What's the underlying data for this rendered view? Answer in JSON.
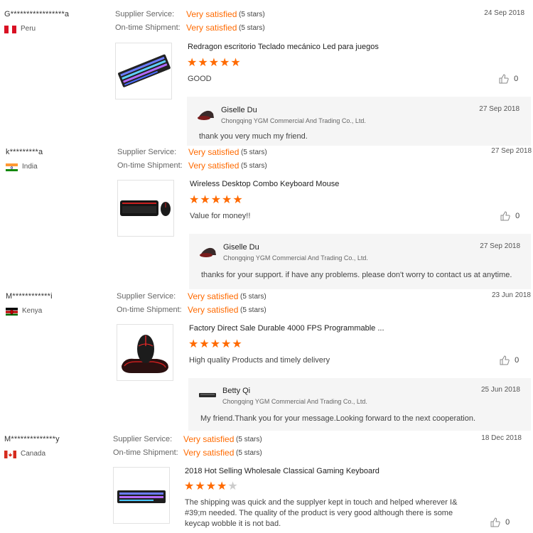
{
  "labels": {
    "supplier_service": "Supplier Service:",
    "ontime_shipment": "On-time Shipment:"
  },
  "reviews": [
    {
      "buyer": "G*****************a",
      "country": "Peru",
      "flag": "peru-flag-icon",
      "date": "24 Sep 2018",
      "supplier_service": "Very satisfied",
      "supplier_service_stars": "(5 stars)",
      "ontime_shipment": "Very satisfied",
      "ontime_shipment_stars": "(5 stars)",
      "product_title": "Redragon escritorio Teclado mecánico Led para juegos",
      "rating": 5,
      "comment": "GOOD",
      "likes": "0",
      "reply": {
        "name": "Giselle Du",
        "company": "Chongqing YGM Commercial And Trading Co., Ltd.",
        "date": "27 Sep 2018",
        "text": "thank you very much my friend."
      }
    },
    {
      "buyer": "k*********a",
      "country": "India",
      "flag": "india-flag-icon",
      "date": "27 Sep 2018",
      "supplier_service": "Very satisfied",
      "supplier_service_stars": "(5 stars)",
      "ontime_shipment": "Very satisfied",
      "ontime_shipment_stars": "(5 stars)",
      "product_title": "Wireless Desktop Combo Keyboard Mouse",
      "rating": 5,
      "comment": "Value for money!!",
      "likes": "0",
      "reply": {
        "name": "Giselle Du",
        "company": "Chongqing YGM Commercial And Trading Co., Ltd.",
        "date": "27 Sep 2018",
        "text": "thanks for your support. if have any problems. please don't worry to contact us at anytime."
      }
    },
    {
      "buyer": "M************i",
      "country": "Kenya",
      "flag": "kenya-flag-icon",
      "date": "23 Jun 2018",
      "supplier_service": "Very satisfied",
      "supplier_service_stars": "(5 stars)",
      "ontime_shipment": "Very satisfied",
      "ontime_shipment_stars": "(5 stars)",
      "product_title": "Factory Direct Sale Durable 4000 FPS Programmable ...",
      "rating": 5,
      "comment": "High quality Products and timely delivery",
      "likes": "0",
      "reply": {
        "name": "Betty Qi",
        "company": "Chongqing YGM Commercial And Trading Co., Ltd.",
        "date": "25 Jun 2018",
        "text": "My friend.Thank you for your message.Looking forward to the next cooperation."
      }
    },
    {
      "buyer": "M**************y",
      "country": "Canada",
      "flag": "canada-flag-icon",
      "date": "18 Dec 2018",
      "supplier_service": "Very satisfied",
      "supplier_service_stars": "(5 stars)",
      "ontime_shipment": "Very satisfied",
      "ontime_shipment_stars": "(5 stars)",
      "product_title": "2018 Hot Selling Wholesale Classical Gaming Keyboard",
      "rating": 4,
      "comment_lines": [
        "The shipping was quick and the supplyer kept in touch and helped wherever I&",
        "#39;m needed. The quality of the product is very good although there is some",
        "keycap wobble it is not bad."
      ],
      "likes": "0"
    }
  ]
}
